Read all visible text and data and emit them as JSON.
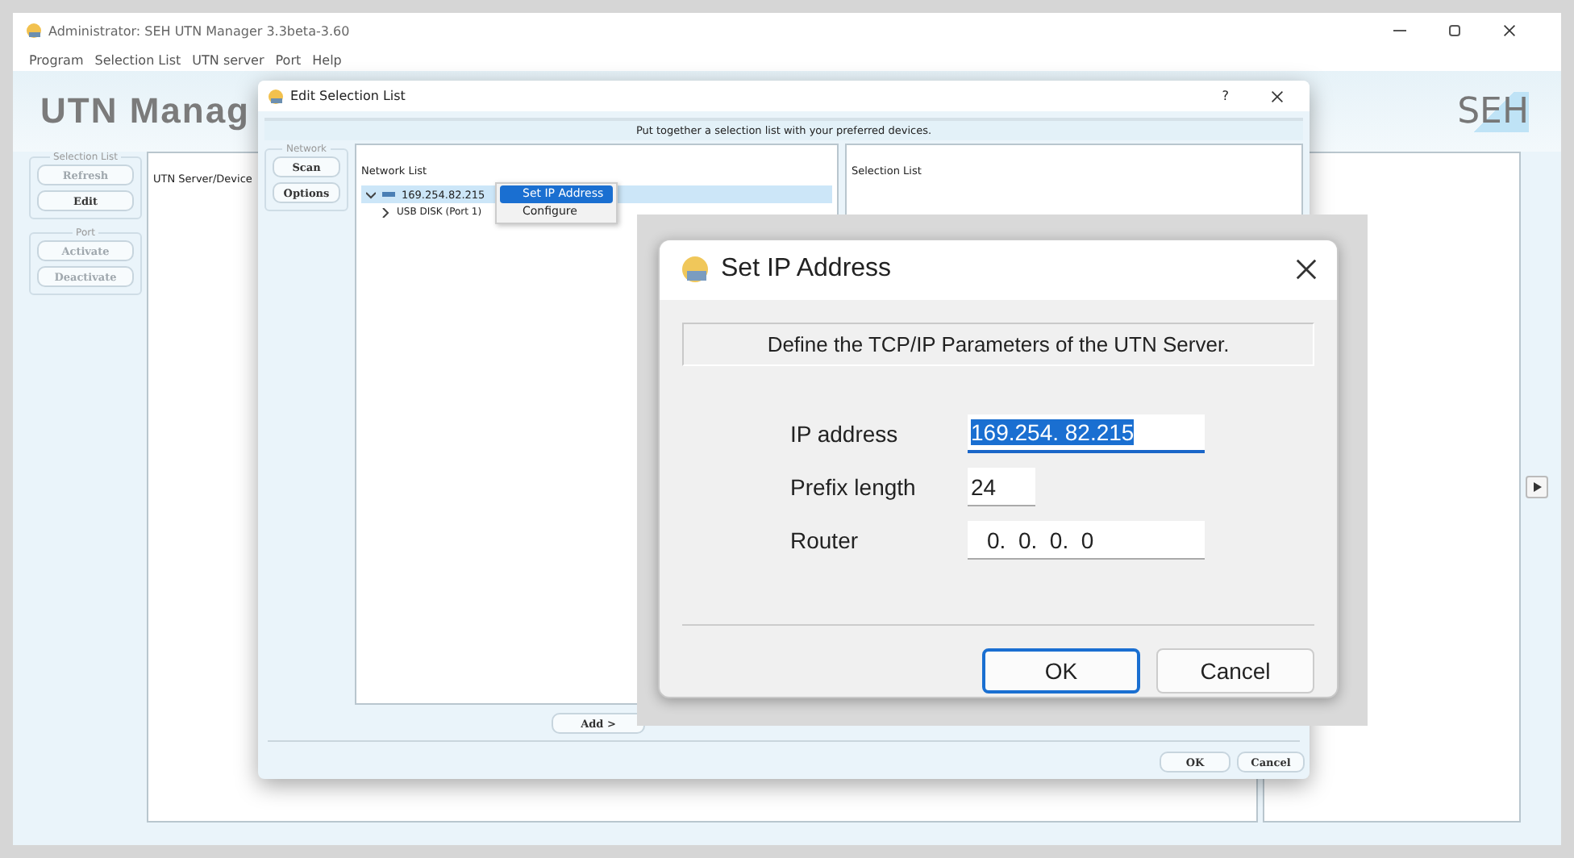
{
  "main_window": {
    "title": "Administrator: SEH UTN Manager 3.3beta-3.60",
    "menu": [
      "Program",
      "Selection List",
      "UTN server",
      "Port",
      "Help"
    ],
    "banner_title": "UTN Manag",
    "logo": "SEH",
    "groups": [
      {
        "title": "Selection List",
        "buttons": [
          {
            "label": "Refresh",
            "disabled": true
          },
          {
            "label": "Edit",
            "disabled": false
          }
        ]
      },
      {
        "title": "Port",
        "buttons": [
          {
            "label": "Activate",
            "disabled": true
          },
          {
            "label": "Deactivate",
            "disabled": true
          }
        ]
      }
    ],
    "list_header": "UTN Server/Device"
  },
  "edit_dialog": {
    "title": "Edit Selection List",
    "help": "?",
    "hint": "Put together a selection list with your preferred devices.",
    "network_group": {
      "title": "Network",
      "buttons": [
        "Scan",
        "Options"
      ]
    },
    "network_list": {
      "header": "Network List",
      "tree": [
        {
          "label": "169.254.82.215",
          "expanded": true,
          "selected": true,
          "children": [
            {
              "label": "USB DISK (Port 1)",
              "expanded": false,
              "selected": false
            }
          ]
        }
      ]
    },
    "selection_list": {
      "header": "Selection List"
    },
    "add_button": "Add >",
    "buttons": [
      "OK",
      "Cancel"
    ]
  },
  "context_menu": [
    {
      "label": "Set IP Address",
      "selected": true
    },
    {
      "label": "Configure",
      "selected": false
    }
  ],
  "ip_dialog": {
    "title": "Set IP Address",
    "banner": "Define the TCP/IP Parameters of the UTN Server.",
    "fields": [
      {
        "label": "IP address",
        "value": "169.254. 82.215",
        "focused": true
      },
      {
        "label": "Prefix length",
        "value": "24",
        "focused": false
      },
      {
        "label": "Router",
        "value": "0.  0.  0.  0",
        "focused": false
      }
    ],
    "buttons": [
      {
        "label": "OK",
        "default": true
      },
      {
        "label": "Cancel",
        "default": false
      }
    ]
  }
}
